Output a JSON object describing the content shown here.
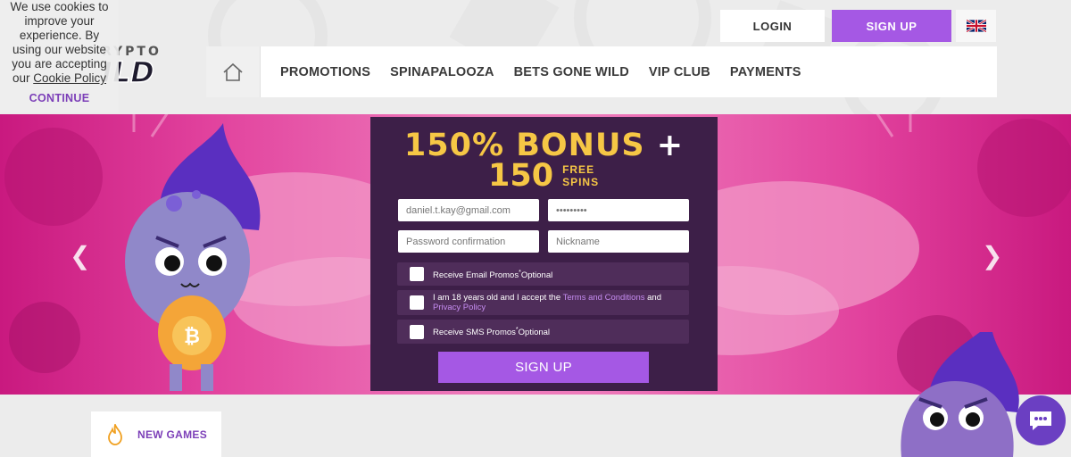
{
  "cookie": {
    "text": "We use cookies to improve your experience. By using our website you are accepting our",
    "link_label": "Cookie Policy",
    "continue_label": "CONTINUE"
  },
  "logo": {
    "text_top": "RYPTO",
    "text_main": "ILD"
  },
  "header": {
    "login_label": "LOGIN",
    "signup_label": "SIGN UP",
    "language_icon": "uk-flag-icon"
  },
  "nav": {
    "home_icon": "home-icon",
    "items": [
      {
        "label": "PROMOTIONS"
      },
      {
        "label": "SPINAPALOOZA"
      },
      {
        "label": "BETS GONE WILD"
      },
      {
        "label": "VIP CLUB"
      },
      {
        "label": "PAYMENTS"
      }
    ]
  },
  "banner": {
    "bonus_line1": "150% BONUS",
    "plus": "+",
    "bonus_spins": "150",
    "free_label": "FREE",
    "spins_label": "SPINS"
  },
  "form": {
    "email_value": "daniel.t.kay@gmail.com",
    "password_value": "•••••••••",
    "password_confirm_placeholder": "Password confirmation",
    "nickname_placeholder": "Nickname",
    "checks": [
      {
        "text": "Receive Email Promos",
        "suffix": "Optional"
      },
      {
        "text": "I am 18 years old and I accept the",
        "link1": "Terms and Conditions",
        "and": "and",
        "link2": "Privacy Policy"
      },
      {
        "text": "Receive SMS Promos",
        "suffix": "Optional"
      }
    ],
    "submit_label": "SIGN UP"
  },
  "sections": {
    "new_games_label": "NEW GAMES"
  },
  "colors": {
    "accent_purple": "#a558e4",
    "panel_bg": "#3d1f48",
    "bonus_yellow": "#f6c745",
    "banner_pink": "#e2439e"
  }
}
